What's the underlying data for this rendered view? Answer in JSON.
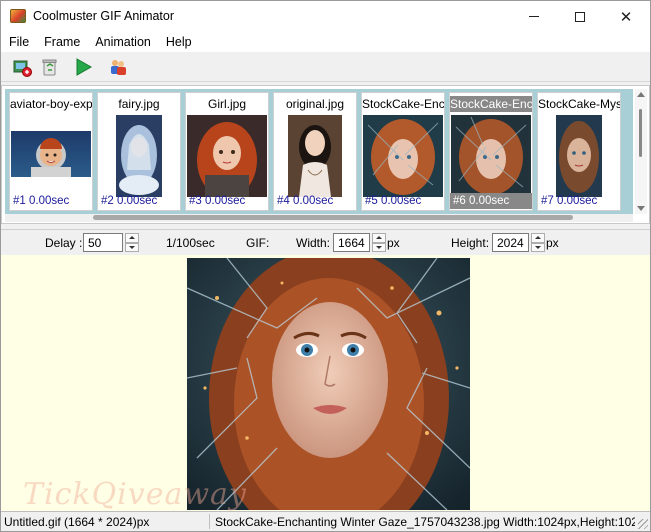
{
  "window": {
    "title": "Coolmuster GIF Animator"
  },
  "menu": [
    "File",
    "Frame",
    "Animation",
    "Help"
  ],
  "toolbar": [
    {
      "name": "add-frames-icon",
      "tooltip": ""
    },
    {
      "name": "delete-frame-icon",
      "tooltip": ""
    },
    {
      "name": "play-icon",
      "tooltip": ""
    },
    {
      "name": "users-icon",
      "tooltip": ""
    }
  ],
  "frames": [
    {
      "name": "aviator-boy-exp",
      "index": "#1",
      "delay": "0.00sec",
      "selected": false
    },
    {
      "name": "fairy.jpg",
      "index": "#2",
      "delay": "0.00sec",
      "selected": false
    },
    {
      "name": "Girl.jpg",
      "index": "#3",
      "delay": "0.00sec",
      "selected": false
    },
    {
      "name": "original.jpg",
      "index": "#4",
      "delay": "0.00sec",
      "selected": false
    },
    {
      "name": "StockCake-Enc",
      "index": "#5",
      "delay": "0.00sec",
      "selected": false
    },
    {
      "name": "StockCake-Enc",
      "index": "#6",
      "delay": "0.00sec",
      "selected": true
    },
    {
      "name": "StockCake-Mys",
      "index": "#7",
      "delay": "0.00sec",
      "selected": false
    }
  ],
  "settings": {
    "delay_label": "Delay :",
    "delay_value": "50",
    "delay_unit": "1/100sec",
    "gif_label": "GIF:",
    "width_label": "Width:",
    "width_value": "1664",
    "width_unit": "px",
    "height_label": "Height:",
    "height_value": "2024",
    "height_unit": "px"
  },
  "watermark": "TickQiveaway",
  "status": {
    "left": "Untitled.gif (1664 * 2024)px",
    "right": "StockCake-Enchanting Winter Gaze_1757043238.jpg Width:1024px,Height:102"
  },
  "colors": {
    "strip_bg": "#a9cfd6",
    "preview_bg": "#ffffe6",
    "frame_label": "#1a1a9a"
  }
}
